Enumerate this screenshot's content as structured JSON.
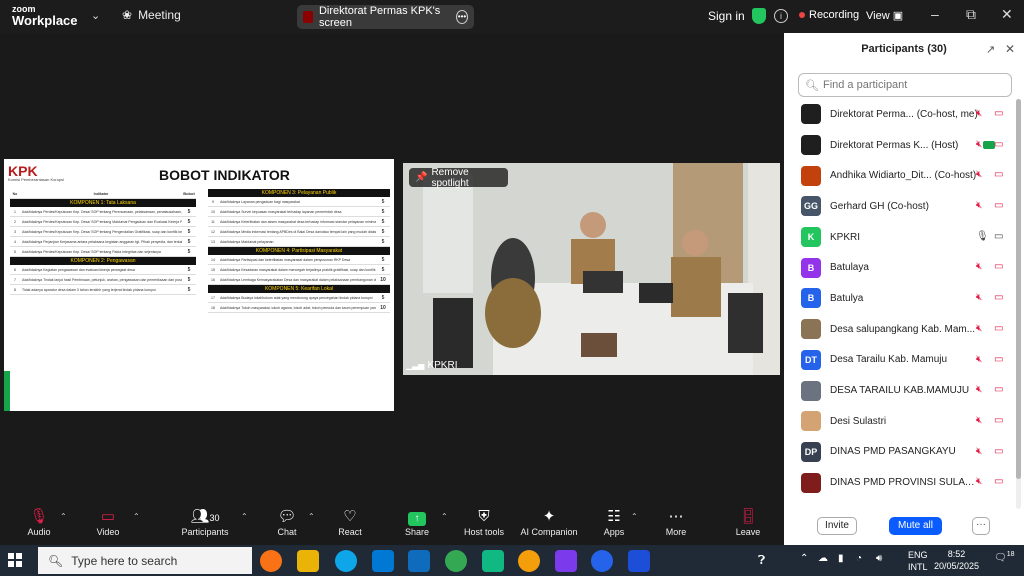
{
  "titlebar": {
    "logo_line1": "zoom",
    "logo_line2": "Workplace",
    "meeting_label": "Meeting",
    "share_title": "Direktorat Permas KPK's screen",
    "signin": "Sign in",
    "recording": "Recording",
    "view": "View"
  },
  "slide": {
    "logo": "KPK",
    "logo_sub": "Komisi Pemberantasan Korupsi",
    "title": "BOBOT INDIKATOR",
    "left_header": [
      "No",
      "Indikator",
      "Bobot"
    ],
    "komponen1": "KOMPONEN 1: Tata Laksana",
    "komponen2": "KOMPONEN 2: Pengawasan",
    "komponen3": "KOMPONEN 3: Pelayanan Publik",
    "komponen4": "KOMPONEN 4: Partisipasi Masyarakat",
    "komponen5": "KOMPONEN 5: Kearifan Lokal",
    "left_rows_1": [
      {
        "n": "1",
        "t": "Ada/tidaknya Perdes/Keputusan Kep. Desa/ SOP tentang Perencanaan, pelaksanaan, penatausahaan, dan pertanggungjawaban APBDes",
        "v": "5"
      },
      {
        "n": "2",
        "t": "Ada/tidaknya Perdes/Keputusan Kep. Desa/ SOP tentang Maklumat Pengaduan dan Evaluasi Kinerja Perangkat Desa",
        "v": "5"
      },
      {
        "n": "3",
        "t": "Ada/tidaknya Perdes/Keputusan Kep. Desa/ SOP tentang Pengendalian Gratifikasi, suap dan konflik kepentingan",
        "v": "5"
      },
      {
        "n": "4",
        "t": "Ada/tidaknya Perjanjian Kerjasama antara pelaksana kegiatan anggaran tgt. Pihak penyedia, dan terkait Pelaksanaan pengadaan barang/jasa di Desa",
        "v": "5"
      },
      {
        "n": "5",
        "t": "Ada/tidaknya Perdes/Keputusan Kep. Desa/ SOP tentang Pakta Integritas dan sejenisnya",
        "v": "5"
      }
    ],
    "left_rows_2": [
      {
        "n": "6",
        "t": "Ada/tidaknya Kegiatan pengawasan dan evaluasi kinerja perangkat desa",
        "v": "5"
      },
      {
        "n": "7",
        "t": "Ada/tidaknya Tindak lanjut hasil Pembinaan, petunjuk, arahan, pengawasan dan pemeriksaan dari pusat/daerah",
        "v": "5"
      },
      {
        "n": "8",
        "t": "Tidak adanya aparatur desa dalam 3 tahun terakhir yang terjerat tindak pidana korupsi",
        "v": "5"
      }
    ],
    "right_rows_3": [
      {
        "n": "9",
        "t": "Ada/tidaknya Layanan pengaduan bagi masyarakat",
        "v": "5"
      },
      {
        "n": "10",
        "t": "Ada/tidaknya Survei kepuasan masyarakat terhadap layanan pemerintah desa",
        "v": "5"
      },
      {
        "n": "11",
        "t": "Ada/tidaknya Keterlibatan dan akses masyarakat desa terhadap informasi standar pelayanan minimal kesehatan, pendidikan, sosial, lingkungan",
        "v": "5"
      },
      {
        "n": "12",
        "t": "Ada/tidaknya Media informasi tentang APBDes di Balai Desa dan/atau tempat lain yang mudah diakses masyarakat",
        "v": "5"
      },
      {
        "n": "13",
        "t": "Ada/tidaknya Maklumat pelayanan",
        "v": "5"
      }
    ],
    "right_rows_4": [
      {
        "n": "14",
        "t": "Ada/tidaknya Partisipasi dan keterlibatan masyarakat dalam penyusunan RKP Desa",
        "v": "5"
      },
      {
        "n": "15",
        "t": "Ada/tidaknya Kesadaran masyarakat dalam mencegah terjadinya praktik gratifikasi, suap dan konflik kepentingan",
        "v": "5"
      },
      {
        "n": "16",
        "t": "Ada/tidaknya Lembaga Kemasyarakatan Desa dan masyarakat dalam pelaksanaan pembangunan desa",
        "v": "10"
      }
    ],
    "right_rows_5": [
      {
        "n": "17",
        "t": "Ada/tidaknya Budaya lokal/hukum adat yang mendorong upaya pencegahan tindak pidana korupsi",
        "v": "5"
      },
      {
        "n": "18",
        "t": "Ada/tidaknya Tokoh masyarakat, tokoh agama, tokoh adat, tokoh pemuda dan kaum perempuan yang mendorong upaya pencegahan tindak pidana korupsi",
        "v": "10"
      }
    ]
  },
  "video": {
    "remove_spotlight": "Remove spotlight",
    "name": "KPKRI"
  },
  "panel": {
    "title": "Participants (30)",
    "search_placeholder": "Find a participant",
    "participants": [
      {
        "name": "Direktorat Perma... (Co-host, me)",
        "initials": "",
        "color": "#1f1f1f",
        "mic": "muted",
        "cc": false
      },
      {
        "name": "Direktorat Permas K... (Host)",
        "initials": "",
        "color": "#1f1f1f",
        "mic": "muted",
        "cc": true
      },
      {
        "name": "Andhika Widiarto_Dit... (Co-host)",
        "initials": "",
        "color": "#c2410c",
        "mic": "muted",
        "cc": false
      },
      {
        "name": "Gerhard GH (Co-host)",
        "initials": "GG",
        "color": "#475569",
        "mic": "muted",
        "cc": false
      },
      {
        "name": "KPKRI",
        "initials": "K",
        "color": "#22c55e",
        "mic": "on",
        "cc": false
      },
      {
        "name": "Batulaya",
        "initials": "B",
        "color": "#9333ea",
        "mic": "muted",
        "cc": false
      },
      {
        "name": "Batulya",
        "initials": "B",
        "color": "#2563eb",
        "mic": "muted",
        "cc": false
      },
      {
        "name": "Desa salupangkang Kab. Mam...",
        "initials": "",
        "color": "#8b7355",
        "mic": "muted",
        "cc": false
      },
      {
        "name": "Desa Tarailu Kab. Mamuju",
        "initials": "DT",
        "color": "#2563eb",
        "mic": "muted",
        "cc": false
      },
      {
        "name": "DESA TARAILU KAB.MAMUJU",
        "initials": "",
        "color": "#6b7280",
        "mic": "muted",
        "cc": false
      },
      {
        "name": "Desi Sulastri",
        "initials": "",
        "color": "#d4a373",
        "mic": "muted",
        "cc": false
      },
      {
        "name": "DINAS PMD PASANGKAYU",
        "initials": "DP",
        "color": "#374151",
        "mic": "muted",
        "cc": false
      },
      {
        "name": "DINAS PMD PROVINSI SULAWE...",
        "initials": "",
        "color": "#7f1d1d",
        "mic": "muted",
        "cc": false
      }
    ],
    "invite": "Invite",
    "mute_all": "Mute all",
    "more": "···"
  },
  "toolbar": {
    "audio": "Audio",
    "video": "Video",
    "participants": "Participants",
    "participants_count": "30",
    "chat": "Chat",
    "react": "React",
    "share": "Share",
    "host_tools": "Host tools",
    "ai_companion": "AI Companion",
    "apps": "Apps",
    "more": "More",
    "leave": "Leave"
  },
  "taskbar": {
    "search_placeholder": "Type here to search",
    "lang1": "ENG",
    "lang2": "INTL",
    "time": "8:52",
    "date": "20/05/2025",
    "notif": "18"
  },
  "colors": {
    "accent": "#0b5cff",
    "recording": "#ef4444",
    "muted": "#e11d48",
    "share_green": "#22c55e"
  }
}
